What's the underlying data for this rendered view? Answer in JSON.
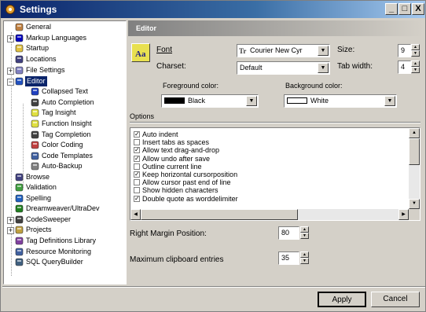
{
  "window": {
    "title": "Settings",
    "min": "_",
    "max": "□",
    "close": "X"
  },
  "tree": [
    {
      "label": "General",
      "icon": "gear-icon",
      "color": "#c08040"
    },
    {
      "label": "Markup Languages",
      "icon": "markup-icon",
      "color": "#0000c0"
    },
    {
      "label": "Startup",
      "icon": "folder-icon",
      "color": "#e0c040"
    },
    {
      "label": "Locations",
      "icon": "locations-icon",
      "color": "#404080"
    },
    {
      "label": "File Settings",
      "icon": "file-icon",
      "color": "#8080c0"
    },
    {
      "label": "Editor",
      "icon": "editor-icon",
      "color": "#2050c0"
    },
    {
      "label": "Collapsed Text",
      "icon": "collapsed-text-icon",
      "color": "#2040c0"
    },
    {
      "label": "Auto Completion",
      "icon": "auto-completion-icon",
      "color": "#404040"
    },
    {
      "label": "Tag Insight",
      "icon": "lightbulb-icon",
      "color": "#e0e040"
    },
    {
      "label": "Function Insight",
      "icon": "lightbulb-icon",
      "color": "#e0e040"
    },
    {
      "label": "Tag Completion",
      "icon": "glasses-icon",
      "color": "#404040"
    },
    {
      "label": "Color Coding",
      "icon": "color-coding-icon",
      "color": "#c04040"
    },
    {
      "label": "Code Templates",
      "icon": "document-icon",
      "color": "#4060a0"
    },
    {
      "label": "Auto-Backup",
      "icon": "backup-icon",
      "color": "#808080"
    },
    {
      "label": "Browse",
      "icon": "browse-icon",
      "color": "#404080"
    },
    {
      "label": "Validation",
      "icon": "validation-icon",
      "color": "#40a040"
    },
    {
      "label": "Spelling",
      "icon": "spelling-icon",
      "color": "#2060c0"
    },
    {
      "label": "Dreamweaver/UltraDev",
      "icon": "dreamweaver-icon",
      "color": "#208020"
    },
    {
      "label": "CodeSweeper",
      "icon": "codesweeper-icon",
      "color": "#404040"
    },
    {
      "label": "Projects",
      "icon": "projects-icon",
      "color": "#c0a040"
    },
    {
      "label": "Tag Definitions Library",
      "icon": "library-icon",
      "color": "#8040a0"
    },
    {
      "label": "Resource Monitoring",
      "icon": "monitor-icon",
      "color": "#4060a0"
    },
    {
      "label": "SQL QueryBuilder",
      "icon": "sql-icon",
      "color": "#406080"
    }
  ],
  "panel": {
    "header": "Editor",
    "font_label": "Font",
    "font_value": "Courier New Cyr",
    "size_label": "Size:",
    "size_value": "9",
    "charset_label": "Charset:",
    "charset_value": "Default",
    "tab_label": "Tab width:",
    "tab_value": "4",
    "fg_label": "Foreground color:",
    "fg_value": "Black",
    "fg_color": "#000000",
    "bg_label": "Background color:",
    "bg_value": "White",
    "bg_color": "#ffffff",
    "options_label": "Options",
    "options": [
      {
        "label": "Auto indent",
        "checked": true
      },
      {
        "label": "Insert tabs as spaces",
        "checked": false
      },
      {
        "label": "Allow text drag-and-drop",
        "checked": true
      },
      {
        "label": "Allow undo after save",
        "checked": true
      },
      {
        "label": "Outline current line",
        "checked": false
      },
      {
        "label": "Keep horizontal cursorposition",
        "checked": true
      },
      {
        "label": "Allow cursor past end of line",
        "checked": false
      },
      {
        "label": "Show hidden characters",
        "checked": false
      },
      {
        "label": "Double quote as worddelimiter",
        "checked": true
      }
    ],
    "right_margin_label": "Right Margin Position:",
    "right_margin_value": "80",
    "clipboard_label": "Maximum clipboard entries",
    "clipboard_value": "35"
  },
  "buttons": {
    "apply": "Apply",
    "cancel": "Cancel"
  }
}
